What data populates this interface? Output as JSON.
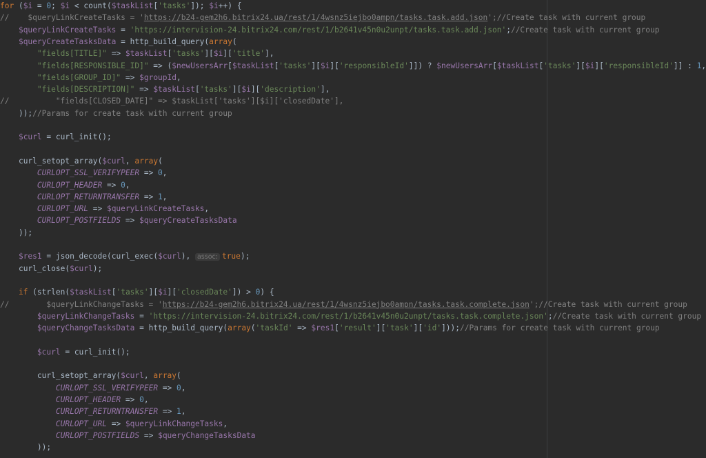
{
  "editor": {
    "colors": {
      "background": "#2b2b2b",
      "keyword": "#cc7832",
      "variable": "#9876aa",
      "string": "#6a8759",
      "number": "#6897bb",
      "comment": "#808080",
      "text": "#a9b7c6"
    },
    "lines": [
      {
        "indent": 0,
        "tokens": [
          [
            "kw",
            "for"
          ],
          [
            "plain",
            " ("
          ],
          [
            "var",
            "$i"
          ],
          [
            "plain",
            " = "
          ],
          [
            "num",
            "0"
          ],
          [
            "plain",
            "; "
          ],
          [
            "var",
            "$i"
          ],
          [
            "plain",
            " < "
          ],
          [
            "fn",
            "count"
          ],
          [
            "plain",
            "("
          ],
          [
            "var",
            "$taskList"
          ],
          [
            "plain",
            "["
          ],
          [
            "str",
            "'tasks'"
          ],
          [
            "plain",
            "]); "
          ],
          [
            "var",
            "$i"
          ],
          [
            "plain",
            "++) {"
          ]
        ]
      },
      {
        "indent": 0,
        "tokens": [
          [
            "cmt",
            "//    $queryLinkCreateTasks = '"
          ],
          [
            "link",
            "https://b24-gem2h6.bitrix24.ua/rest/1/4wsnz5iejbo0ampn/tasks.task.add.json"
          ],
          [
            "cmt",
            "';//Create task with current group"
          ]
        ]
      },
      {
        "indent": 4,
        "tokens": [
          [
            "var",
            "$queryLinkCreateTasks"
          ],
          [
            "plain",
            " = "
          ],
          [
            "str",
            "'https://intervision-24.bitrix24.com/rest/1/b2641v45n0u2unpt/tasks.task.add.json'"
          ],
          [
            "plain",
            ";"
          ],
          [
            "cmt",
            "//Create task with current group"
          ]
        ]
      },
      {
        "indent": 4,
        "tokens": [
          [
            "var",
            "$queryCreateTasksData"
          ],
          [
            "plain",
            " = "
          ],
          [
            "fn",
            "http_build_query"
          ],
          [
            "plain",
            "("
          ],
          [
            "kw",
            "array"
          ],
          [
            "plain",
            "("
          ]
        ]
      },
      {
        "indent": 8,
        "tokens": [
          [
            "str",
            "\"fields[TITLE]\""
          ],
          [
            "plain",
            " => "
          ],
          [
            "var",
            "$taskList"
          ],
          [
            "plain",
            "["
          ],
          [
            "str",
            "'tasks'"
          ],
          [
            "plain",
            "]["
          ],
          [
            "var",
            "$i"
          ],
          [
            "plain",
            "]["
          ],
          [
            "str",
            "'title'"
          ],
          [
            "plain",
            "],"
          ]
        ]
      },
      {
        "indent": 8,
        "tokens": [
          [
            "str",
            "\"fields[RESPONSIBLE_ID]\""
          ],
          [
            "plain",
            " => ("
          ],
          [
            "var",
            "$newUsersArr"
          ],
          [
            "plain",
            "["
          ],
          [
            "var",
            "$taskList"
          ],
          [
            "plain",
            "["
          ],
          [
            "str",
            "'tasks'"
          ],
          [
            "plain",
            "]["
          ],
          [
            "var",
            "$i"
          ],
          [
            "plain",
            "]["
          ],
          [
            "str",
            "'responsibleId'"
          ],
          [
            "plain",
            "]]) ? "
          ],
          [
            "var",
            "$newUsersArr"
          ],
          [
            "plain",
            "["
          ],
          [
            "var",
            "$taskList"
          ],
          [
            "plain",
            "["
          ],
          [
            "str",
            "'tasks'"
          ],
          [
            "plain",
            "]["
          ],
          [
            "var",
            "$i"
          ],
          [
            "plain",
            "]["
          ],
          [
            "str",
            "'responsibleId'"
          ],
          [
            "plain",
            "]] : "
          ],
          [
            "num",
            "1"
          ],
          [
            "plain",
            ","
          ],
          [
            "cmt",
            "//"
          ]
        ]
      },
      {
        "indent": 8,
        "tokens": [
          [
            "str",
            "\"fields[GROUP_ID]\""
          ],
          [
            "plain",
            " => "
          ],
          [
            "var",
            "$groupId"
          ],
          [
            "plain",
            ","
          ]
        ]
      },
      {
        "indent": 8,
        "tokens": [
          [
            "str",
            "\"fields[DESCRIPTION]\""
          ],
          [
            "plain",
            " => "
          ],
          [
            "var",
            "$taskList"
          ],
          [
            "plain",
            "["
          ],
          [
            "str",
            "'tasks'"
          ],
          [
            "plain",
            "]["
          ],
          [
            "var",
            "$i"
          ],
          [
            "plain",
            "]["
          ],
          [
            "str",
            "'description'"
          ],
          [
            "plain",
            "],"
          ]
        ]
      },
      {
        "indent": 0,
        "tokens": [
          [
            "cmt",
            "//          \"fields[CLOSED_DATE]\" => $taskList['tasks'][$i]['closedDate'],"
          ]
        ]
      },
      {
        "indent": 4,
        "tokens": [
          [
            "plain",
            "));"
          ],
          [
            "cmt",
            "//Params for create task with current group"
          ]
        ]
      },
      {
        "indent": 0,
        "tokens": []
      },
      {
        "indent": 4,
        "tokens": [
          [
            "var",
            "$curl"
          ],
          [
            "plain",
            " = "
          ],
          [
            "fn",
            "curl_init"
          ],
          [
            "plain",
            "();"
          ]
        ]
      },
      {
        "indent": 0,
        "tokens": []
      },
      {
        "indent": 4,
        "tokens": [
          [
            "fn",
            "curl_setopt_array"
          ],
          [
            "plain",
            "("
          ],
          [
            "var",
            "$curl"
          ],
          [
            "plain",
            ", "
          ],
          [
            "kw",
            "array"
          ],
          [
            "plain",
            "("
          ]
        ]
      },
      {
        "indent": 8,
        "tokens": [
          [
            "const",
            "CURLOPT_SSL_VERIFYPEER"
          ],
          [
            "plain",
            " => "
          ],
          [
            "num",
            "0"
          ],
          [
            "plain",
            ","
          ]
        ]
      },
      {
        "indent": 8,
        "tokens": [
          [
            "const",
            "CURLOPT_HEADER"
          ],
          [
            "plain",
            " => "
          ],
          [
            "num",
            "0"
          ],
          [
            "plain",
            ","
          ]
        ]
      },
      {
        "indent": 8,
        "tokens": [
          [
            "const",
            "CURLOPT_RETURNTRANSFER"
          ],
          [
            "plain",
            " => "
          ],
          [
            "num",
            "1"
          ],
          [
            "plain",
            ","
          ]
        ]
      },
      {
        "indent": 8,
        "tokens": [
          [
            "const",
            "CURLOPT_URL"
          ],
          [
            "plain",
            " => "
          ],
          [
            "var",
            "$queryLinkCreateTasks"
          ],
          [
            "plain",
            ","
          ]
        ]
      },
      {
        "indent": 8,
        "tokens": [
          [
            "const",
            "CURLOPT_POSTFIELDS"
          ],
          [
            "plain",
            " => "
          ],
          [
            "var",
            "$queryCreateTasksData"
          ]
        ]
      },
      {
        "indent": 4,
        "tokens": [
          [
            "plain",
            "));"
          ]
        ]
      },
      {
        "indent": 0,
        "tokens": []
      },
      {
        "indent": 4,
        "tokens": [
          [
            "var",
            "$res1"
          ],
          [
            "plain",
            " = "
          ],
          [
            "fn",
            "json_decode"
          ],
          [
            "plain",
            "("
          ],
          [
            "fn",
            "curl_exec"
          ],
          [
            "plain",
            "("
          ],
          [
            "var",
            "$curl"
          ],
          [
            "plain",
            "), "
          ],
          [
            "hint",
            "assoc:"
          ],
          [
            "kw",
            "true"
          ],
          [
            "plain",
            ");"
          ]
        ]
      },
      {
        "indent": 4,
        "tokens": [
          [
            "fn",
            "curl_close"
          ],
          [
            "plain",
            "("
          ],
          [
            "var",
            "$curl"
          ],
          [
            "plain",
            ");"
          ]
        ]
      },
      {
        "indent": 0,
        "tokens": []
      },
      {
        "indent": 4,
        "tokens": [
          [
            "kw",
            "if"
          ],
          [
            "plain",
            " ("
          ],
          [
            "fn",
            "strlen"
          ],
          [
            "plain",
            "("
          ],
          [
            "var",
            "$taskList"
          ],
          [
            "plain",
            "["
          ],
          [
            "str",
            "'tasks'"
          ],
          [
            "plain",
            "]["
          ],
          [
            "var",
            "$i"
          ],
          [
            "plain",
            "]["
          ],
          [
            "str",
            "'closedDate'"
          ],
          [
            "plain",
            "]) > "
          ],
          [
            "num",
            "0"
          ],
          [
            "plain",
            ") {"
          ]
        ]
      },
      {
        "indent": 0,
        "tokens": [
          [
            "cmt",
            "//        $queryLinkChangeTasks = '"
          ],
          [
            "link",
            "https://b24-gem2h6.bitrix24.ua/rest/1/4wsnz5iejbo0ampn/tasks.task.complete.json"
          ],
          [
            "cmt",
            "';//Create task with current group"
          ]
        ]
      },
      {
        "indent": 8,
        "tokens": [
          [
            "var",
            "$queryLinkChangeTasks"
          ],
          [
            "plain",
            " = "
          ],
          [
            "str",
            "'https://intervision-24.bitrix24.com/rest/1/b2641v45n0u2unpt/tasks.task.complete.json'"
          ],
          [
            "plain",
            ";"
          ],
          [
            "cmt",
            "//Create task with current group"
          ]
        ]
      },
      {
        "indent": 8,
        "tokens": [
          [
            "var",
            "$queryChangeTasksData"
          ],
          [
            "plain",
            " = "
          ],
          [
            "fn",
            "http_build_query"
          ],
          [
            "plain",
            "("
          ],
          [
            "kw",
            "array"
          ],
          [
            "plain",
            "("
          ],
          [
            "str",
            "'taskId'"
          ],
          [
            "plain",
            " => "
          ],
          [
            "var",
            "$res1"
          ],
          [
            "plain",
            "["
          ],
          [
            "str",
            "'result'"
          ],
          [
            "plain",
            "]["
          ],
          [
            "str",
            "'task'"
          ],
          [
            "plain",
            "]["
          ],
          [
            "str",
            "'id'"
          ],
          [
            "plain",
            "]));"
          ],
          [
            "cmt",
            "//Params for create task with current group"
          ]
        ]
      },
      {
        "indent": 0,
        "tokens": []
      },
      {
        "indent": 8,
        "tokens": [
          [
            "var",
            "$curl"
          ],
          [
            "plain",
            " = "
          ],
          [
            "fn",
            "curl_init"
          ],
          [
            "plain",
            "();"
          ]
        ]
      },
      {
        "indent": 0,
        "tokens": []
      },
      {
        "indent": 8,
        "tokens": [
          [
            "fn",
            "curl_setopt_array"
          ],
          [
            "plain",
            "("
          ],
          [
            "var",
            "$curl"
          ],
          [
            "plain",
            ", "
          ],
          [
            "kw",
            "array"
          ],
          [
            "plain",
            "("
          ]
        ]
      },
      {
        "indent": 12,
        "tokens": [
          [
            "const",
            "CURLOPT_SSL_VERIFYPEER"
          ],
          [
            "plain",
            " => "
          ],
          [
            "num",
            "0"
          ],
          [
            "plain",
            ","
          ]
        ]
      },
      {
        "indent": 12,
        "tokens": [
          [
            "const",
            "CURLOPT_HEADER"
          ],
          [
            "plain",
            " => "
          ],
          [
            "num",
            "0"
          ],
          [
            "plain",
            ","
          ]
        ]
      },
      {
        "indent": 12,
        "tokens": [
          [
            "const",
            "CURLOPT_RETURNTRANSFER"
          ],
          [
            "plain",
            " => "
          ],
          [
            "num",
            "1"
          ],
          [
            "plain",
            ","
          ]
        ]
      },
      {
        "indent": 12,
        "tokens": [
          [
            "const",
            "CURLOPT_URL"
          ],
          [
            "plain",
            " => "
          ],
          [
            "var",
            "$queryLinkChangeTasks"
          ],
          [
            "plain",
            ","
          ]
        ]
      },
      {
        "indent": 12,
        "tokens": [
          [
            "const",
            "CURLOPT_POSTFIELDS"
          ],
          [
            "plain",
            " => "
          ],
          [
            "var",
            "$queryChangeTasksData"
          ]
        ]
      },
      {
        "indent": 8,
        "tokens": [
          [
            "plain",
            "));"
          ]
        ]
      }
    ]
  }
}
